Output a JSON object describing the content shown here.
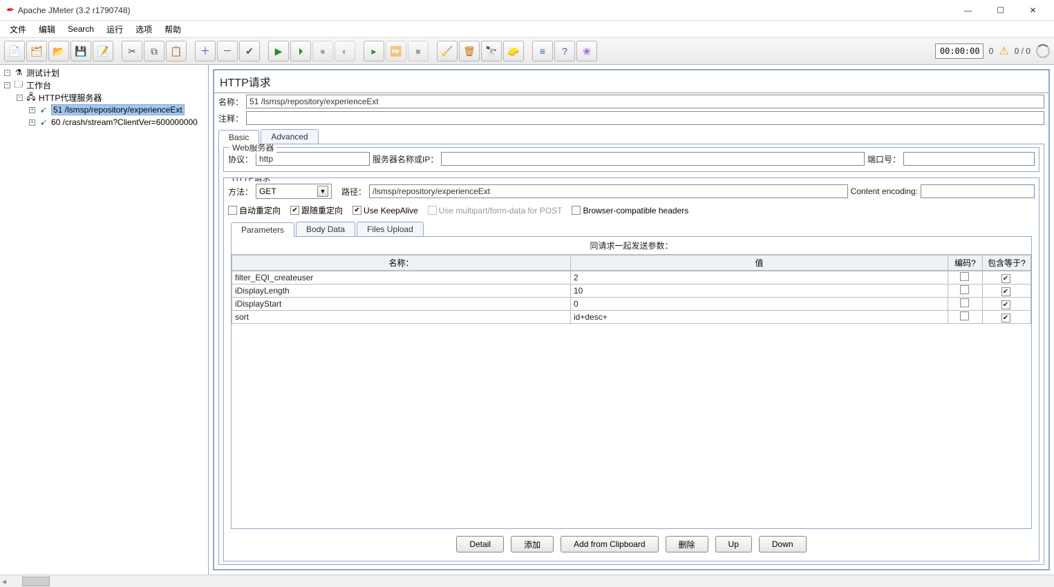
{
  "window": {
    "title": "Apache JMeter (3.2 r1790748)"
  },
  "menu": {
    "file": "文件",
    "edit": "编辑",
    "search": "Search",
    "run": "运行",
    "options": "选项",
    "help": "帮助"
  },
  "status": {
    "timer": "00:00:00",
    "warn_count": "0",
    "threads": "0 / 0"
  },
  "tree": {
    "test_plan": "测试计划",
    "workbench": "工作台",
    "proxy": "HTTP代理服务器",
    "sampler_51": "51 /lsmsp/repository/experienceExt",
    "sampler_60": "60 /crash/stream?ClientVer=600000000"
  },
  "panel": {
    "title": "HTTP请求",
    "name_label": "名称：",
    "name_value": "51 /lsmsp/repository/experienceExt",
    "comment_label": "注释：",
    "comment_value": "",
    "tab_basic": "Basic",
    "tab_advanced": "Advanced",
    "webserver_legend": "Web服务器",
    "protocol_label": "协议：",
    "protocol_value": "http",
    "server_label": "服务器名称或IP：",
    "server_value": "",
    "port_label": "端口号：",
    "port_value": "",
    "request_legend": "HTTP请求",
    "method_label": "方法：",
    "method_value": "GET",
    "path_label": "路径：",
    "path_value": "/lsmsp/repository/experienceExt",
    "encoding_label": "Content encoding:",
    "encoding_value": "",
    "chk_auto_redirect": "自动重定向",
    "chk_follow_redirect": "跟随重定向",
    "chk_keepalive": "Use KeepAlive",
    "chk_multipart": "Use multipart/form-data for POST",
    "chk_browser_compat": "Browser-compatible headers",
    "tab_params": "Parameters",
    "tab_body": "Body Data",
    "tab_files": "Files Upload",
    "param_caption": "同请求一起发送参数：",
    "col_name": "名称：",
    "col_value": "值",
    "col_encode": "编码?",
    "col_include": "包含等于?",
    "rows": [
      {
        "name": "filter_EQI_createuser",
        "value": "2",
        "encode": false,
        "include": true
      },
      {
        "name": "iDisplayLength",
        "value": "10",
        "encode": false,
        "include": true
      },
      {
        "name": "iDisplayStart",
        "value": "0",
        "encode": false,
        "include": true
      },
      {
        "name": "sort",
        "value": "id+desc+",
        "encode": false,
        "include": true
      }
    ],
    "btn_detail": "Detail",
    "btn_add": "添加",
    "btn_clipboard": "Add from Clipboard",
    "btn_delete": "删除",
    "btn_up": "Up",
    "btn_down": "Down"
  }
}
